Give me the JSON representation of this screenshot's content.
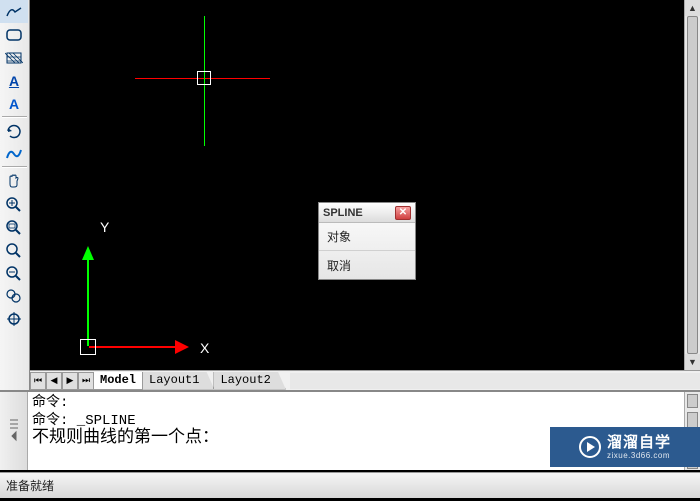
{
  "toolbar": {
    "icons": [
      "polyline-icon",
      "rectangle-icon",
      "hatch-icon",
      "text-annotation-icon",
      "text-icon",
      "",
      "rotate-icon",
      "spline-icon",
      "",
      "pan-icon",
      "zoom-in-icon",
      "zoom-window-icon",
      "zoom-extents-icon",
      "zoom-realtime-icon",
      "zoom-scale-icon",
      "zoom-center-icon"
    ]
  },
  "ucs": {
    "x_label": "X",
    "y_label": "Y"
  },
  "popup": {
    "title": "SPLINE",
    "items": [
      "对象",
      "取消"
    ]
  },
  "tabs": {
    "items": [
      "Model",
      "Layout1",
      "Layout2"
    ],
    "active_index": 0
  },
  "command": {
    "line1": "命令:",
    "line2": "命令: _SPLINE",
    "prompt": "不规则曲线的第一个点："
  },
  "status": {
    "text": "准备就绪"
  },
  "watermark": {
    "brand": "溜溜自学",
    "sub": "zixue.3d66.com"
  }
}
